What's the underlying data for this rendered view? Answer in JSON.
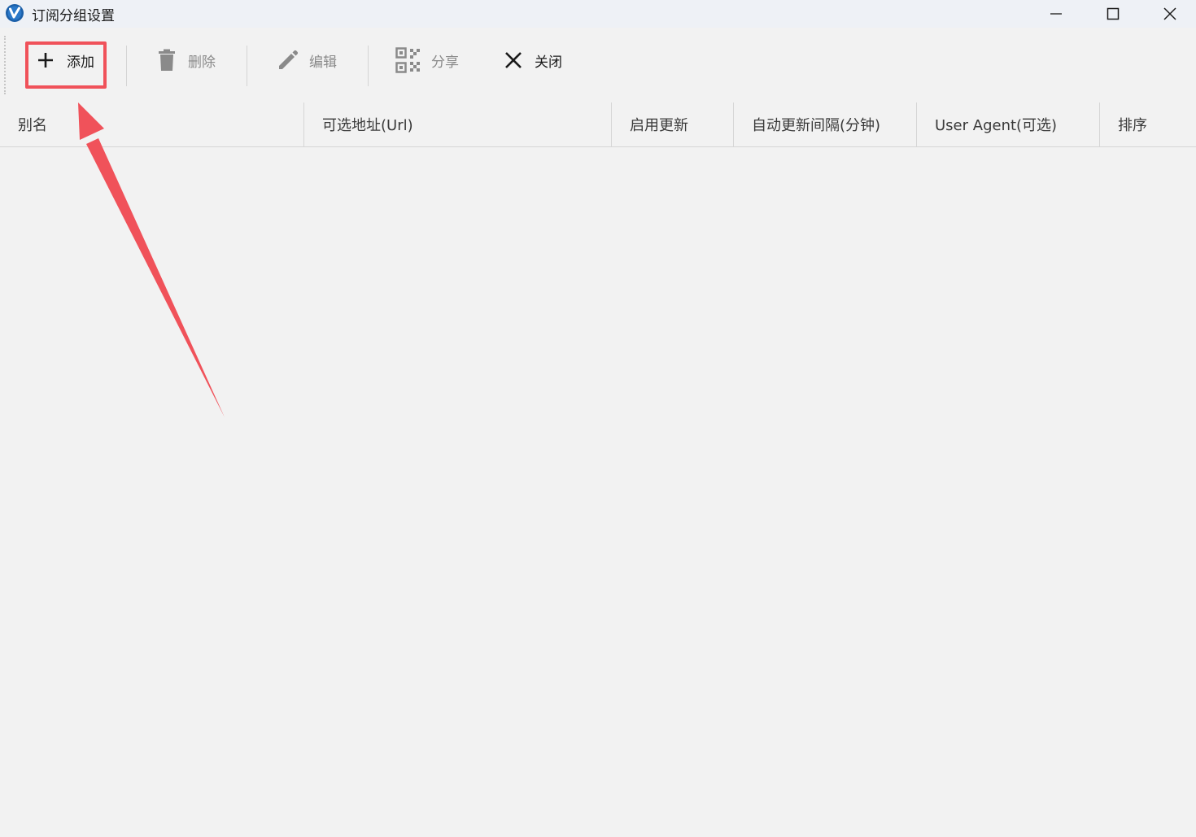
{
  "window": {
    "title": "订阅分组设置",
    "icon": "app-v-logo-icon",
    "controls": [
      "minimize-icon",
      "maximize-icon",
      "close-icon"
    ]
  },
  "toolbar": {
    "add_label": "添加",
    "delete_label": "删除",
    "edit_label": "编辑",
    "share_label": "分享",
    "close_label": "关闭"
  },
  "table": {
    "columns": [
      "别名",
      "可选地址(Url)",
      "启用更新",
      "自动更新间隔(分钟)",
      "User Agent(可选)",
      "排序"
    ],
    "rows": []
  },
  "colors": {
    "annotation": "#f0525a",
    "logo_blue": "#1b5fa8"
  }
}
